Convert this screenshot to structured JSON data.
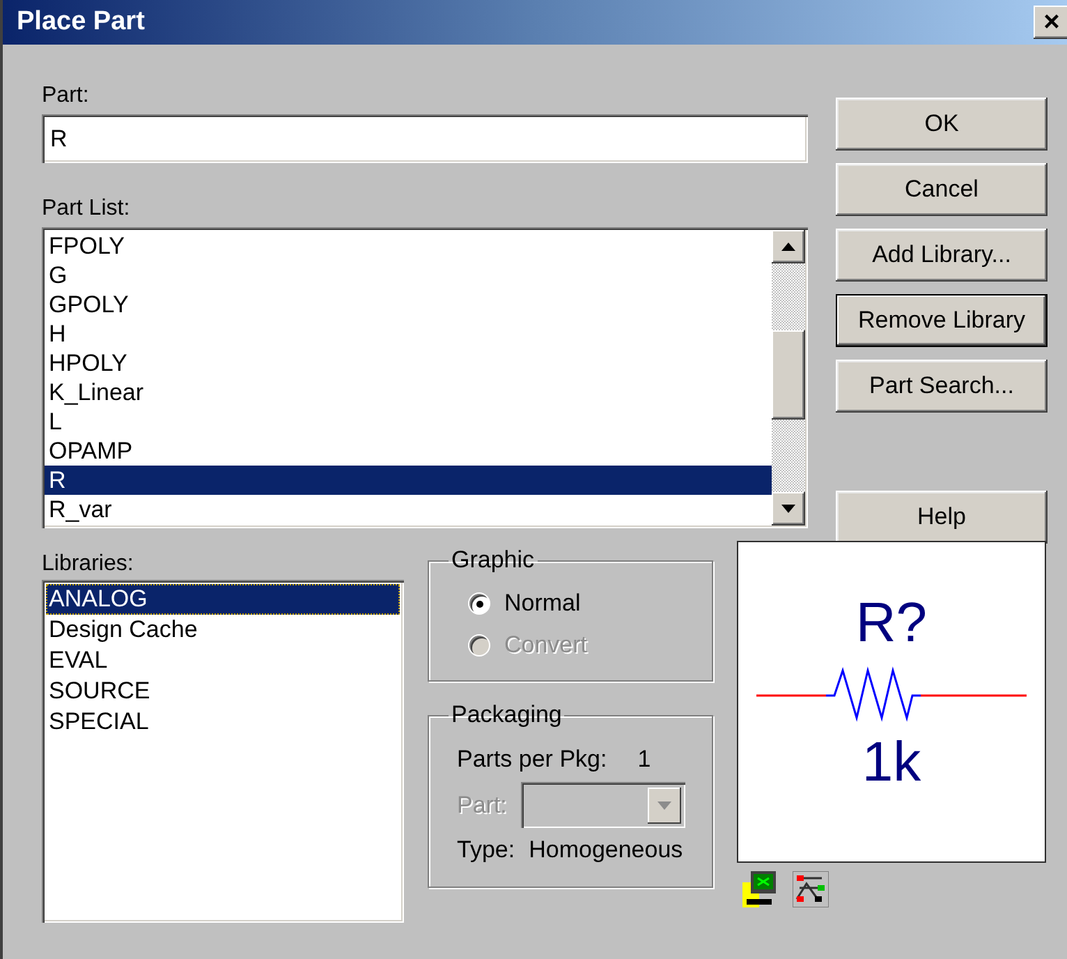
{
  "window": {
    "title": "Place Part",
    "close_glyph": "×"
  },
  "part_field": {
    "label": "Part:",
    "value": "R"
  },
  "part_list": {
    "label": "Part List:",
    "items": [
      {
        "text": "FPOLY",
        "selected": false
      },
      {
        "text": "G",
        "selected": false
      },
      {
        "text": "GPOLY",
        "selected": false
      },
      {
        "text": "H",
        "selected": false
      },
      {
        "text": "HPOLY",
        "selected": false
      },
      {
        "text": "K_Linear",
        "selected": false
      },
      {
        "text": "L",
        "selected": false
      },
      {
        "text": "OPAMP",
        "selected": false
      },
      {
        "text": "R",
        "selected": true
      },
      {
        "text": "R_var",
        "selected": false
      }
    ]
  },
  "buttons": [
    {
      "label": "OK",
      "default": false
    },
    {
      "label": "Cancel",
      "default": false
    },
    {
      "label": "Add Library...",
      "default": false
    },
    {
      "label": "Remove Library",
      "default": true
    },
    {
      "label": "Part Search...",
      "default": false
    }
  ],
  "help_button": {
    "label": "Help",
    "default": false
  },
  "libraries": {
    "label": "Libraries:",
    "items": [
      {
        "text": "ANALOG",
        "selected": true
      },
      {
        "text": "Design Cache",
        "selected": false
      },
      {
        "text": "EVAL",
        "selected": false
      },
      {
        "text": "SOURCE",
        "selected": false
      },
      {
        "text": "SPECIAL",
        "selected": false
      }
    ]
  },
  "graphic": {
    "title": "Graphic",
    "options": [
      {
        "label": "Normal",
        "selected": true,
        "disabled": false
      },
      {
        "label": "Convert",
        "selected": false,
        "disabled": true
      }
    ]
  },
  "packaging": {
    "title": "Packaging",
    "parts_per_pkg_label": "Parts per Pkg:",
    "parts_per_pkg_value": "1",
    "part_label": "Part:",
    "part_disabled": true,
    "type_label": "Type:",
    "type_value": "Homogeneous"
  },
  "preview": {
    "reference": "R?",
    "value": "1k"
  }
}
